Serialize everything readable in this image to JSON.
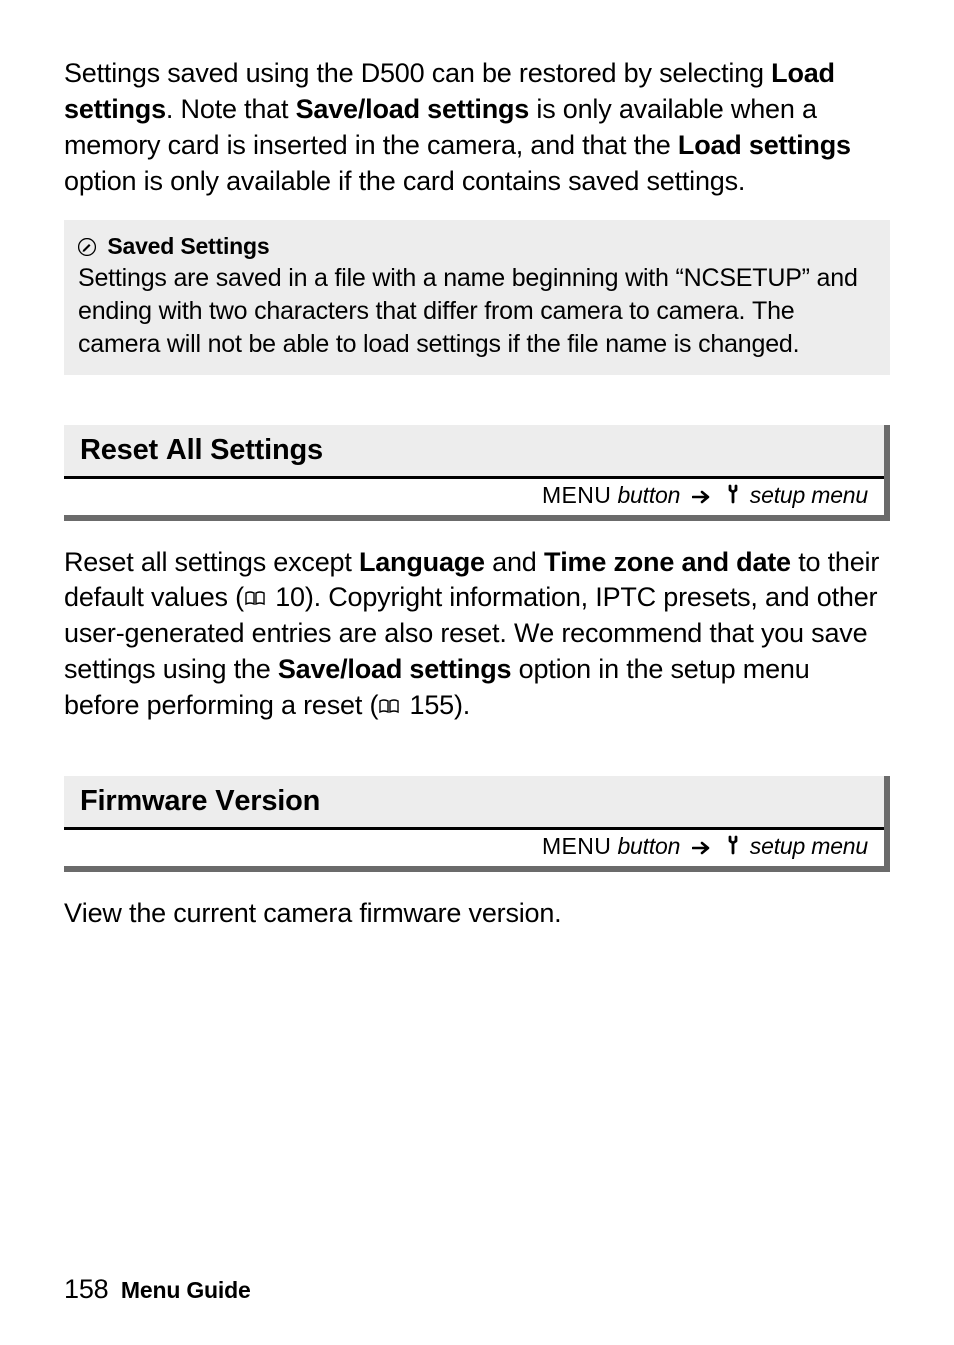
{
  "intro": {
    "t1": "Settings saved using the D500 can be restored by selecting ",
    "b1": "Load settings",
    "t2": ". Note that ",
    "b2": "Save/load settings",
    "t3": " is only available when a memory card is inserted in the camera, and that the ",
    "b3": "Load settings",
    "t4": " option is only available if the card contains saved settings."
  },
  "saved_settings": {
    "title": "Saved Settings",
    "body": "Settings are saved in a file with a name beginning with “NCSETUP” and ending with two characters that differ from camera to camera. The camera will not be able to load settings if the file name is changed."
  },
  "nav": {
    "menu_label": "MENU",
    "button_text": " button",
    "setup_menu": " setup menu"
  },
  "reset": {
    "heading": "Reset All Settings",
    "b1_pre": "Reset all settings except ",
    "bold1": "Language",
    "mid1": " and ",
    "bold2": "Time zone and date",
    "mid2": " to their default values (",
    "ref1": " 10). Copyright information, IPTC presets, and other user-generated entries are also reset. We recommend that you save settings using the ",
    "bold3": "Save/load settings",
    "mid3": " option in the setup menu before performing a reset (",
    "ref2": " 155)."
  },
  "firmware": {
    "heading": "Firmware Version",
    "body": "View the current camera firmware version."
  },
  "footer": {
    "page": "158",
    "guide": "Menu Guide"
  },
  "icons": {
    "pencil": "✎",
    "arrow": "➜",
    "book": "⎘"
  }
}
